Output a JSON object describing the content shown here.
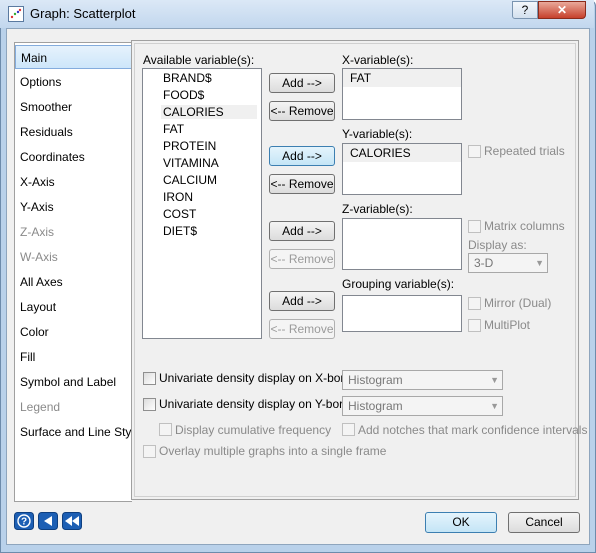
{
  "window": {
    "title": "Graph: Scatterplot",
    "help_glyph": "?",
    "close_glyph": "✕"
  },
  "tabs": [
    {
      "label": "Main",
      "selected": true,
      "enabled": true
    },
    {
      "label": "Options",
      "enabled": true
    },
    {
      "label": "Smoother",
      "enabled": true
    },
    {
      "label": "Residuals",
      "enabled": true
    },
    {
      "label": "Coordinates",
      "enabled": true
    },
    {
      "label": "X-Axis",
      "enabled": true
    },
    {
      "label": "Y-Axis",
      "enabled": true
    },
    {
      "label": "Z-Axis",
      "enabled": false
    },
    {
      "label": "W-Axis",
      "enabled": false
    },
    {
      "label": "All Axes",
      "enabled": true
    },
    {
      "label": "Layout",
      "enabled": true
    },
    {
      "label": "Color",
      "enabled": true
    },
    {
      "label": "Fill",
      "enabled": true
    },
    {
      "label": "Symbol and Label",
      "enabled": true
    },
    {
      "label": "Legend",
      "enabled": false
    },
    {
      "label": "Surface and Line Style",
      "enabled": true
    }
  ],
  "main": {
    "available_label": "Available variable(s):",
    "available": [
      "BRAND$",
      "FOOD$",
      "CALORIES",
      "FAT",
      "PROTEIN",
      "VITAMINA",
      "CALCIUM",
      "IRON",
      "COST",
      "DIET$"
    ],
    "available_highlighted": "CALORIES",
    "x_label": "X-variable(s):",
    "x_value": "FAT",
    "y_label": "Y-variable(s):",
    "y_value": "CALORIES",
    "z_label": "Z-variable(s):",
    "group_label": "Grouping variable(s):",
    "add_label": "Add -->",
    "remove_label": "<-- Remove",
    "repeated_trials": "Repeated trials",
    "matrix_columns": "Matrix columns",
    "display_as_label": "Display as:",
    "display_as_value": "3-D",
    "mirror_dual": "Mirror (Dual)",
    "multiplot": "MultiPlot",
    "density_x": "Univariate density display on X-border",
    "density_x_value": "Histogram",
    "density_y": "Univariate density display on Y-border",
    "density_y_value": "Histogram",
    "cumulative": "Display cumulative frequency",
    "notches": "Add notches that mark confidence intervals",
    "overlay": "Overlay multiple graphs into a single frame"
  },
  "footer": {
    "ok_label": "OK",
    "cancel_label": "Cancel",
    "icons": [
      "help-icon",
      "back-icon",
      "first-icon"
    ],
    "icon_color": "#1d5fb4"
  }
}
